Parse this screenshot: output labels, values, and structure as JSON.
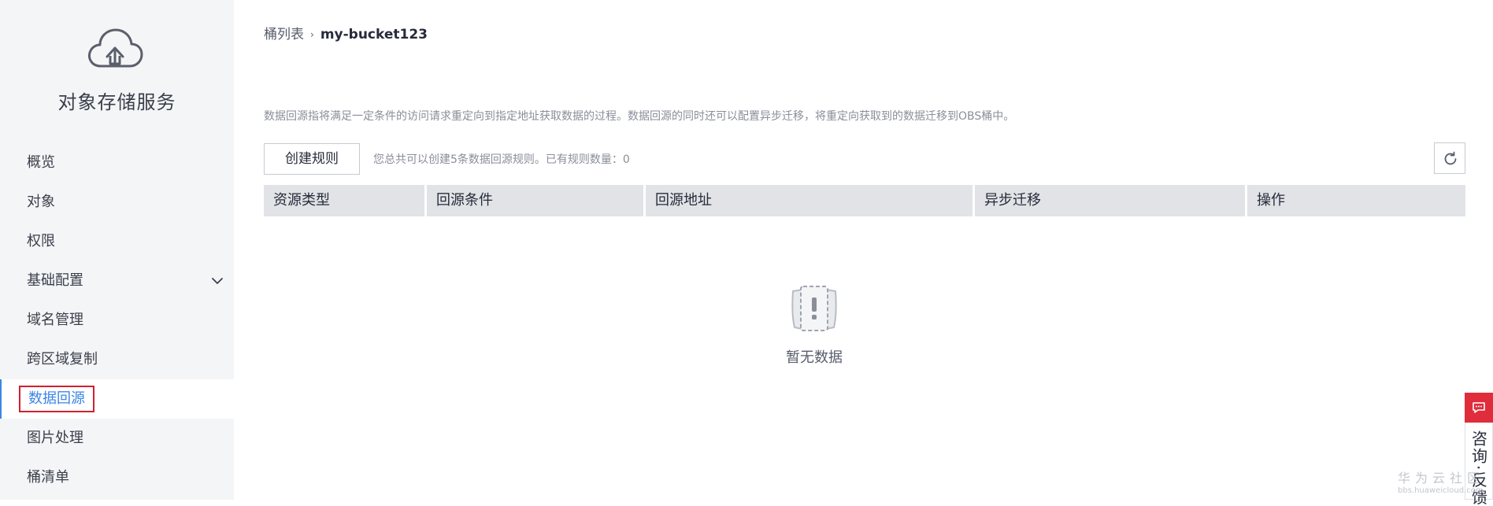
{
  "sidebar": {
    "title": "对象存储服务",
    "icon": "cloud-upload-icon",
    "items": [
      {
        "label": "概览"
      },
      {
        "label": "对象"
      },
      {
        "label": "权限"
      },
      {
        "label": "基础配置"
      },
      {
        "label": "域名管理"
      },
      {
        "label": "跨区域复制"
      },
      {
        "label": "数据回源"
      },
      {
        "label": "图片处理"
      },
      {
        "label": "桶清单"
      }
    ],
    "active_index": 6
  },
  "breadcrumb": {
    "parent": "桶列表",
    "current": "my-bucket123"
  },
  "description": "数据回源指将满足一定条件的访问请求重定向到指定地址获取数据的过程。数据回源的同时还可以配置异步迁移，将重定向获取到的数据迁移到OBS桶中。",
  "toolbar": {
    "create_label": "创建规则",
    "quota_hint": "您总共可以创建5条数据回源规则。已有规则数量：0",
    "refresh_icon": "refresh-icon"
  },
  "table": {
    "columns": [
      "资源类型",
      "回源条件",
      "回源地址",
      "异步迁移",
      "操作"
    ],
    "rows": [],
    "empty_text": "暂无数据"
  },
  "consult": {
    "label": "咨询·反馈"
  },
  "watermark": {
    "title": "华为云社区",
    "url": "bbs.huaweicloud.com"
  },
  "colors": {
    "accent": "#3c85e6",
    "highlight_box": "#d0202e",
    "consult_red": "#e02d3c",
    "sidebar_bg": "#f4f5f7",
    "table_header_bg": "#e1e3e6"
  }
}
